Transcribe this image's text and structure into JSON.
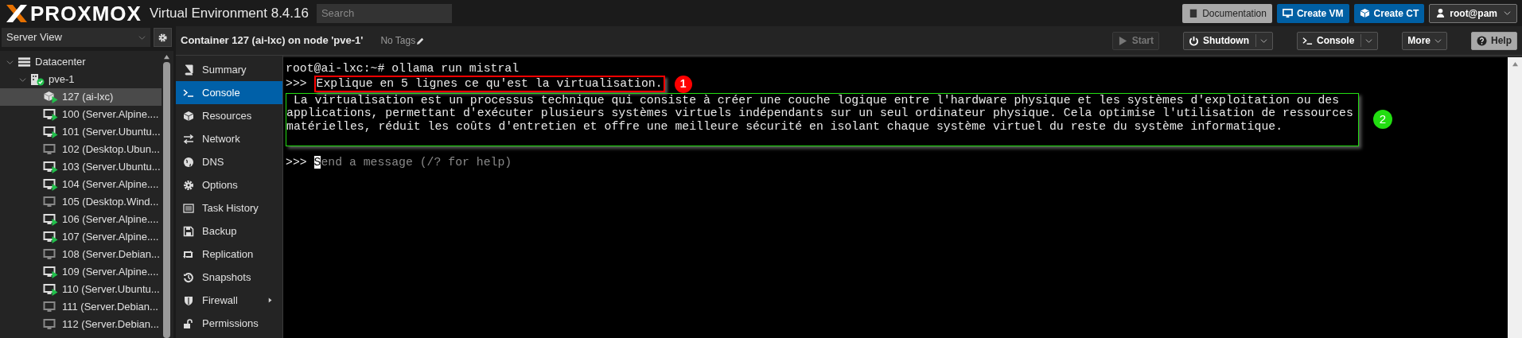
{
  "header": {
    "brand": "PROXMOX",
    "product": "Virtual Environment 8.4.16",
    "search": {
      "placeholder": "Search"
    },
    "buttons": [
      {
        "label": "Documentation",
        "kind": "doc"
      },
      {
        "label": "Create VM",
        "kind": "vm"
      },
      {
        "label": "Create CT",
        "kind": "ct"
      },
      {
        "label": "root@pam",
        "kind": "user"
      }
    ]
  },
  "sidebar": {
    "view": "Server View",
    "tree": [
      {
        "label": "Datacenter",
        "kind": "datacenter",
        "expanded": true,
        "selected": false,
        "children": [
          {
            "label": "pve-1",
            "kind": "node",
            "expanded": true,
            "selected": false,
            "children": [
              {
                "label": "127 (ai-lxc)",
                "kind": "ct",
                "running": true,
                "selected": true
              },
              {
                "label": "100 (Server.Alpine....",
                "kind": "vm",
                "running": true,
                "selected": false
              },
              {
                "label": "101 (Server.Ubuntu...",
                "kind": "vm",
                "running": true,
                "selected": false
              },
              {
                "label": "102 (Desktop.Ubun...",
                "kind": "vm",
                "running": false,
                "selected": false
              },
              {
                "label": "103 (Server.Ubuntu...",
                "kind": "vm",
                "running": true,
                "selected": false
              },
              {
                "label": "104 (Server.Alpine....",
                "kind": "vm",
                "running": true,
                "selected": false
              },
              {
                "label": "105 (Desktop.Wind...",
                "kind": "vm",
                "running": false,
                "selected": false
              },
              {
                "label": "106 (Server.Alpine....",
                "kind": "vm",
                "running": true,
                "selected": false
              },
              {
                "label": "107 (Server.Alpine....",
                "kind": "vm",
                "running": true,
                "selected": false
              },
              {
                "label": "108 (Server.Debian...",
                "kind": "vm",
                "running": false,
                "selected": false
              },
              {
                "label": "109 (Server.Alpine....",
                "kind": "vm",
                "running": true,
                "selected": false
              },
              {
                "label": "110 (Server.Ubuntu...",
                "kind": "vm",
                "running": true,
                "selected": false
              },
              {
                "label": "111 (Server.Debian...",
                "kind": "vm",
                "running": false,
                "selected": false
              },
              {
                "label": "112 (Server.Debian...",
                "kind": "vm",
                "running": false,
                "selected": false
              }
            ]
          }
        ]
      }
    ]
  },
  "content": {
    "title": "Container 127 (ai-lxc) on node 'pve-1'",
    "tags": "No Tags",
    "toolbar": [
      {
        "label": "Start",
        "kind": "start",
        "disabled": true,
        "split": false,
        "menu": false
      },
      {
        "label": "Shutdown",
        "kind": "power",
        "disabled": false,
        "split": true,
        "menu": false
      },
      {
        "label": "Console",
        "kind": "console",
        "disabled": false,
        "split": true,
        "menu": false
      },
      {
        "label": "More",
        "kind": "none",
        "disabled": false,
        "split": false,
        "menu": true
      },
      {
        "label": "Help",
        "kind": "help",
        "disabled": false,
        "split": false,
        "menu": false
      }
    ],
    "nav": [
      {
        "label": "Summary",
        "selected": false,
        "submenu": false
      },
      {
        "label": "Console",
        "selected": true,
        "submenu": false
      },
      {
        "label": "Resources",
        "selected": false,
        "submenu": false
      },
      {
        "label": "Network",
        "selected": false,
        "submenu": false
      },
      {
        "label": "DNS",
        "selected": false,
        "submenu": false
      },
      {
        "label": "Options",
        "selected": false,
        "submenu": false
      },
      {
        "label": "Task History",
        "selected": false,
        "submenu": false
      },
      {
        "label": "Backup",
        "selected": false,
        "submenu": false
      },
      {
        "label": "Replication",
        "selected": false,
        "submenu": false
      },
      {
        "label": "Snapshots",
        "selected": false,
        "submenu": false
      },
      {
        "label": "Firewall",
        "selected": false,
        "submenu": true
      },
      {
        "label": "Permissions",
        "selected": false,
        "submenu": false
      }
    ],
    "terminal": {
      "command_line": "root@ai-lxc:~# ollama run mistral",
      "prompt": ">>>",
      "question": "Explique en 5 lignes ce qu'est la virtualisation.",
      "answer": [
        " La virtualisation est un processus technique qui consiste à créer une couche logique entre l'hardware physique et les systèmes d'exploitation ou des",
        "applications, permettant d'exécuter plusieurs systèmes virtuels indépendants sur un seul ordinateur physique. Cela optimise l'utilisation de ressources",
        "matérielles, réduit les coûts d'entretien et offre une meilleure sécurité en isolant chaque système virtuel du reste du système informatique."
      ],
      "input_prompt": ">>>",
      "input_placeholder": "Send a message (/? for help)"
    },
    "annotations": [
      {
        "label": "1",
        "color": "#ff0000"
      },
      {
        "label": "2",
        "color": "#22dd11"
      }
    ]
  }
}
